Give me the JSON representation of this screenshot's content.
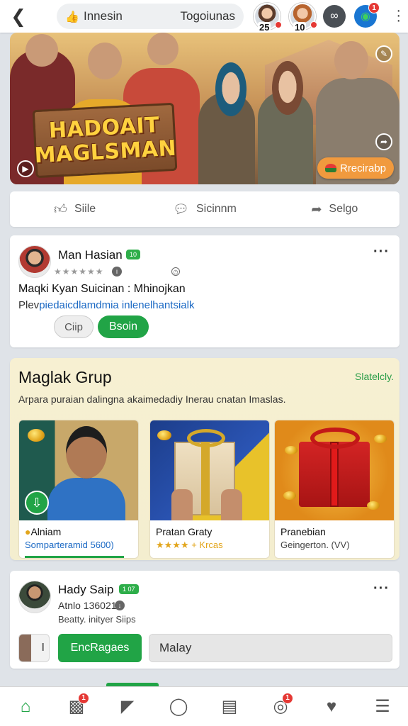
{
  "topbar": {
    "search_left": "Innesin",
    "search_right": "Togoiunas",
    "avatar1_count": "25",
    "avatar2_count": "10",
    "notif_badge": "1"
  },
  "hero": {
    "sign_line1": "HADOAIT",
    "sign_line2": "MAGLSMAN",
    "button_label": "Rrecirabp"
  },
  "actions": [
    {
      "label": "Siile",
      "icon": "thumbs-up-icon"
    },
    {
      "label": "Sicinnm",
      "icon": "comment-icon"
    },
    {
      "label": "Selgo",
      "icon": "share-icon"
    }
  ],
  "post1": {
    "name": "Man Hasian",
    "tag": "10",
    "stars": "★★★★★★",
    "title": "Maqki Kyan Suicinan : Mhinojkan",
    "link_lead": "Plev",
    "link_rest": "piedaicdlamdmia inlenelhantsialk",
    "btn_secondary": "Ciip",
    "btn_primary": "Bsoin"
  },
  "group": {
    "title": "Maglak Grup",
    "link": "Slatelcly.",
    "description": "Arpara puraian dalingna akaimedadiy  Inerau cnatan Imaslas.",
    "cards": [
      {
        "name": "Alniam",
        "sub": "Somparteramid 5600)"
      },
      {
        "name": "Pratan Graty",
        "sub": "★★★★ + Krcas"
      },
      {
        "name": "Pranebian",
        "sub": "Geingerton. (VV)"
      }
    ]
  },
  "post2": {
    "name": "Hady Saip",
    "tag": "1 07",
    "meta": "Atnlo 136021",
    "sub": "Beatty. inityer Siips",
    "thumb_label": "I",
    "btn_primary": "EncRagaes",
    "input_value": "Malay"
  },
  "bottomnav": {
    "badge_a": "1",
    "badge_b": "1"
  }
}
